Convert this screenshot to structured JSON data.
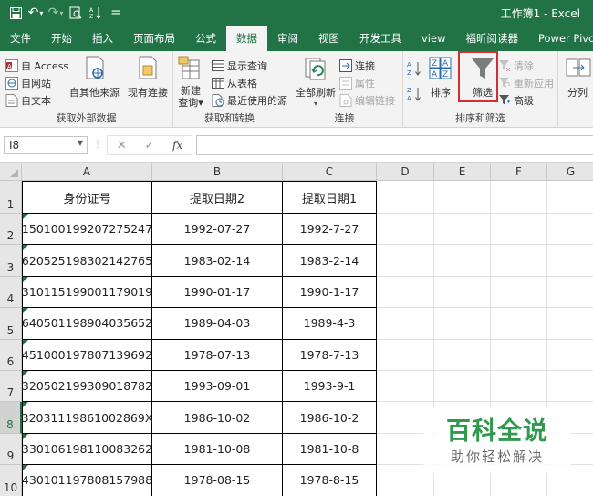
{
  "window": {
    "title": "工作簿1  -  Excel"
  },
  "quick_access": {
    "undo_arrow": "▾",
    "customize": "="
  },
  "tabs": [
    {
      "label": "文件",
      "active": false
    },
    {
      "label": "开始",
      "active": false
    },
    {
      "label": "插入",
      "active": false
    },
    {
      "label": "页面布局",
      "active": false
    },
    {
      "label": "公式",
      "active": false
    },
    {
      "label": "数据",
      "active": true
    },
    {
      "label": "审阅",
      "active": false
    },
    {
      "label": "视图",
      "active": false
    },
    {
      "label": "开发工具",
      "active": false
    },
    {
      "label": "view",
      "active": false
    },
    {
      "label": "福昕阅读器",
      "active": false
    },
    {
      "label": "Power Pivot",
      "active": false
    }
  ],
  "ribbon": {
    "get_external": {
      "access": "自 Access",
      "web": "自网站",
      "text": "自文本",
      "other": "自其他来源",
      "existing": "现有连接",
      "label": "获取外部数据"
    },
    "get_transform": {
      "new_query": "新建\n查询▾",
      "show_queries": "显示查询",
      "from_table": "从表格",
      "recent_sources": "最近使用的源",
      "label": "获取和转换"
    },
    "connections": {
      "refresh_all": "全部刷新",
      "connections": "连接",
      "properties": "属性",
      "edit_links": "编辑链接",
      "label": "连接"
    },
    "sort_filter": {
      "sort": "排序",
      "filter": "筛选",
      "clear": "清除",
      "reapply": "重新应用",
      "advanced": "高级",
      "label": "排序和筛选"
    },
    "outline": {
      "split": "分列"
    }
  },
  "formula_bar": {
    "name_box": "I8",
    "fx": "fx",
    "value": ""
  },
  "columns": [
    "A",
    "B",
    "C",
    "D",
    "E",
    "F",
    "G"
  ],
  "rows": [
    "1",
    "2",
    "3",
    "4",
    "5",
    "6",
    "7",
    "8",
    "9",
    "10"
  ],
  "selected_row": "8",
  "headers": [
    "身份证号",
    "提取日期2",
    "提取日期1"
  ],
  "table": [
    [
      "150100199207275247",
      "1992-07-27",
      "1992-7-27"
    ],
    [
      "620525198302142765",
      "1983-02-14",
      "1983-2-14"
    ],
    [
      "310115199001179019",
      "1990-01-17",
      "1990-1-17"
    ],
    [
      "640501198904035652",
      "1989-04-03",
      "1989-4-3"
    ],
    [
      "451000197807139692",
      "1978-07-13",
      "1978-7-13"
    ],
    [
      "320502199309018782",
      "1993-09-01",
      "1993-9-1"
    ],
    [
      "32031119861002869X",
      "1986-10-02",
      "1986-10-2"
    ],
    [
      "330106198110083262",
      "1981-10-08",
      "1981-10-8"
    ],
    [
      "430101197808157988",
      "1978-08-15",
      "1978-8-15"
    ]
  ],
  "watermark": {
    "title": "百科全说",
    "subtitle": "助你轻松解决"
  },
  "colors": {
    "brand": "#217346",
    "highlight": "#d1302e",
    "watermark_green": "#2f9a4b"
  }
}
